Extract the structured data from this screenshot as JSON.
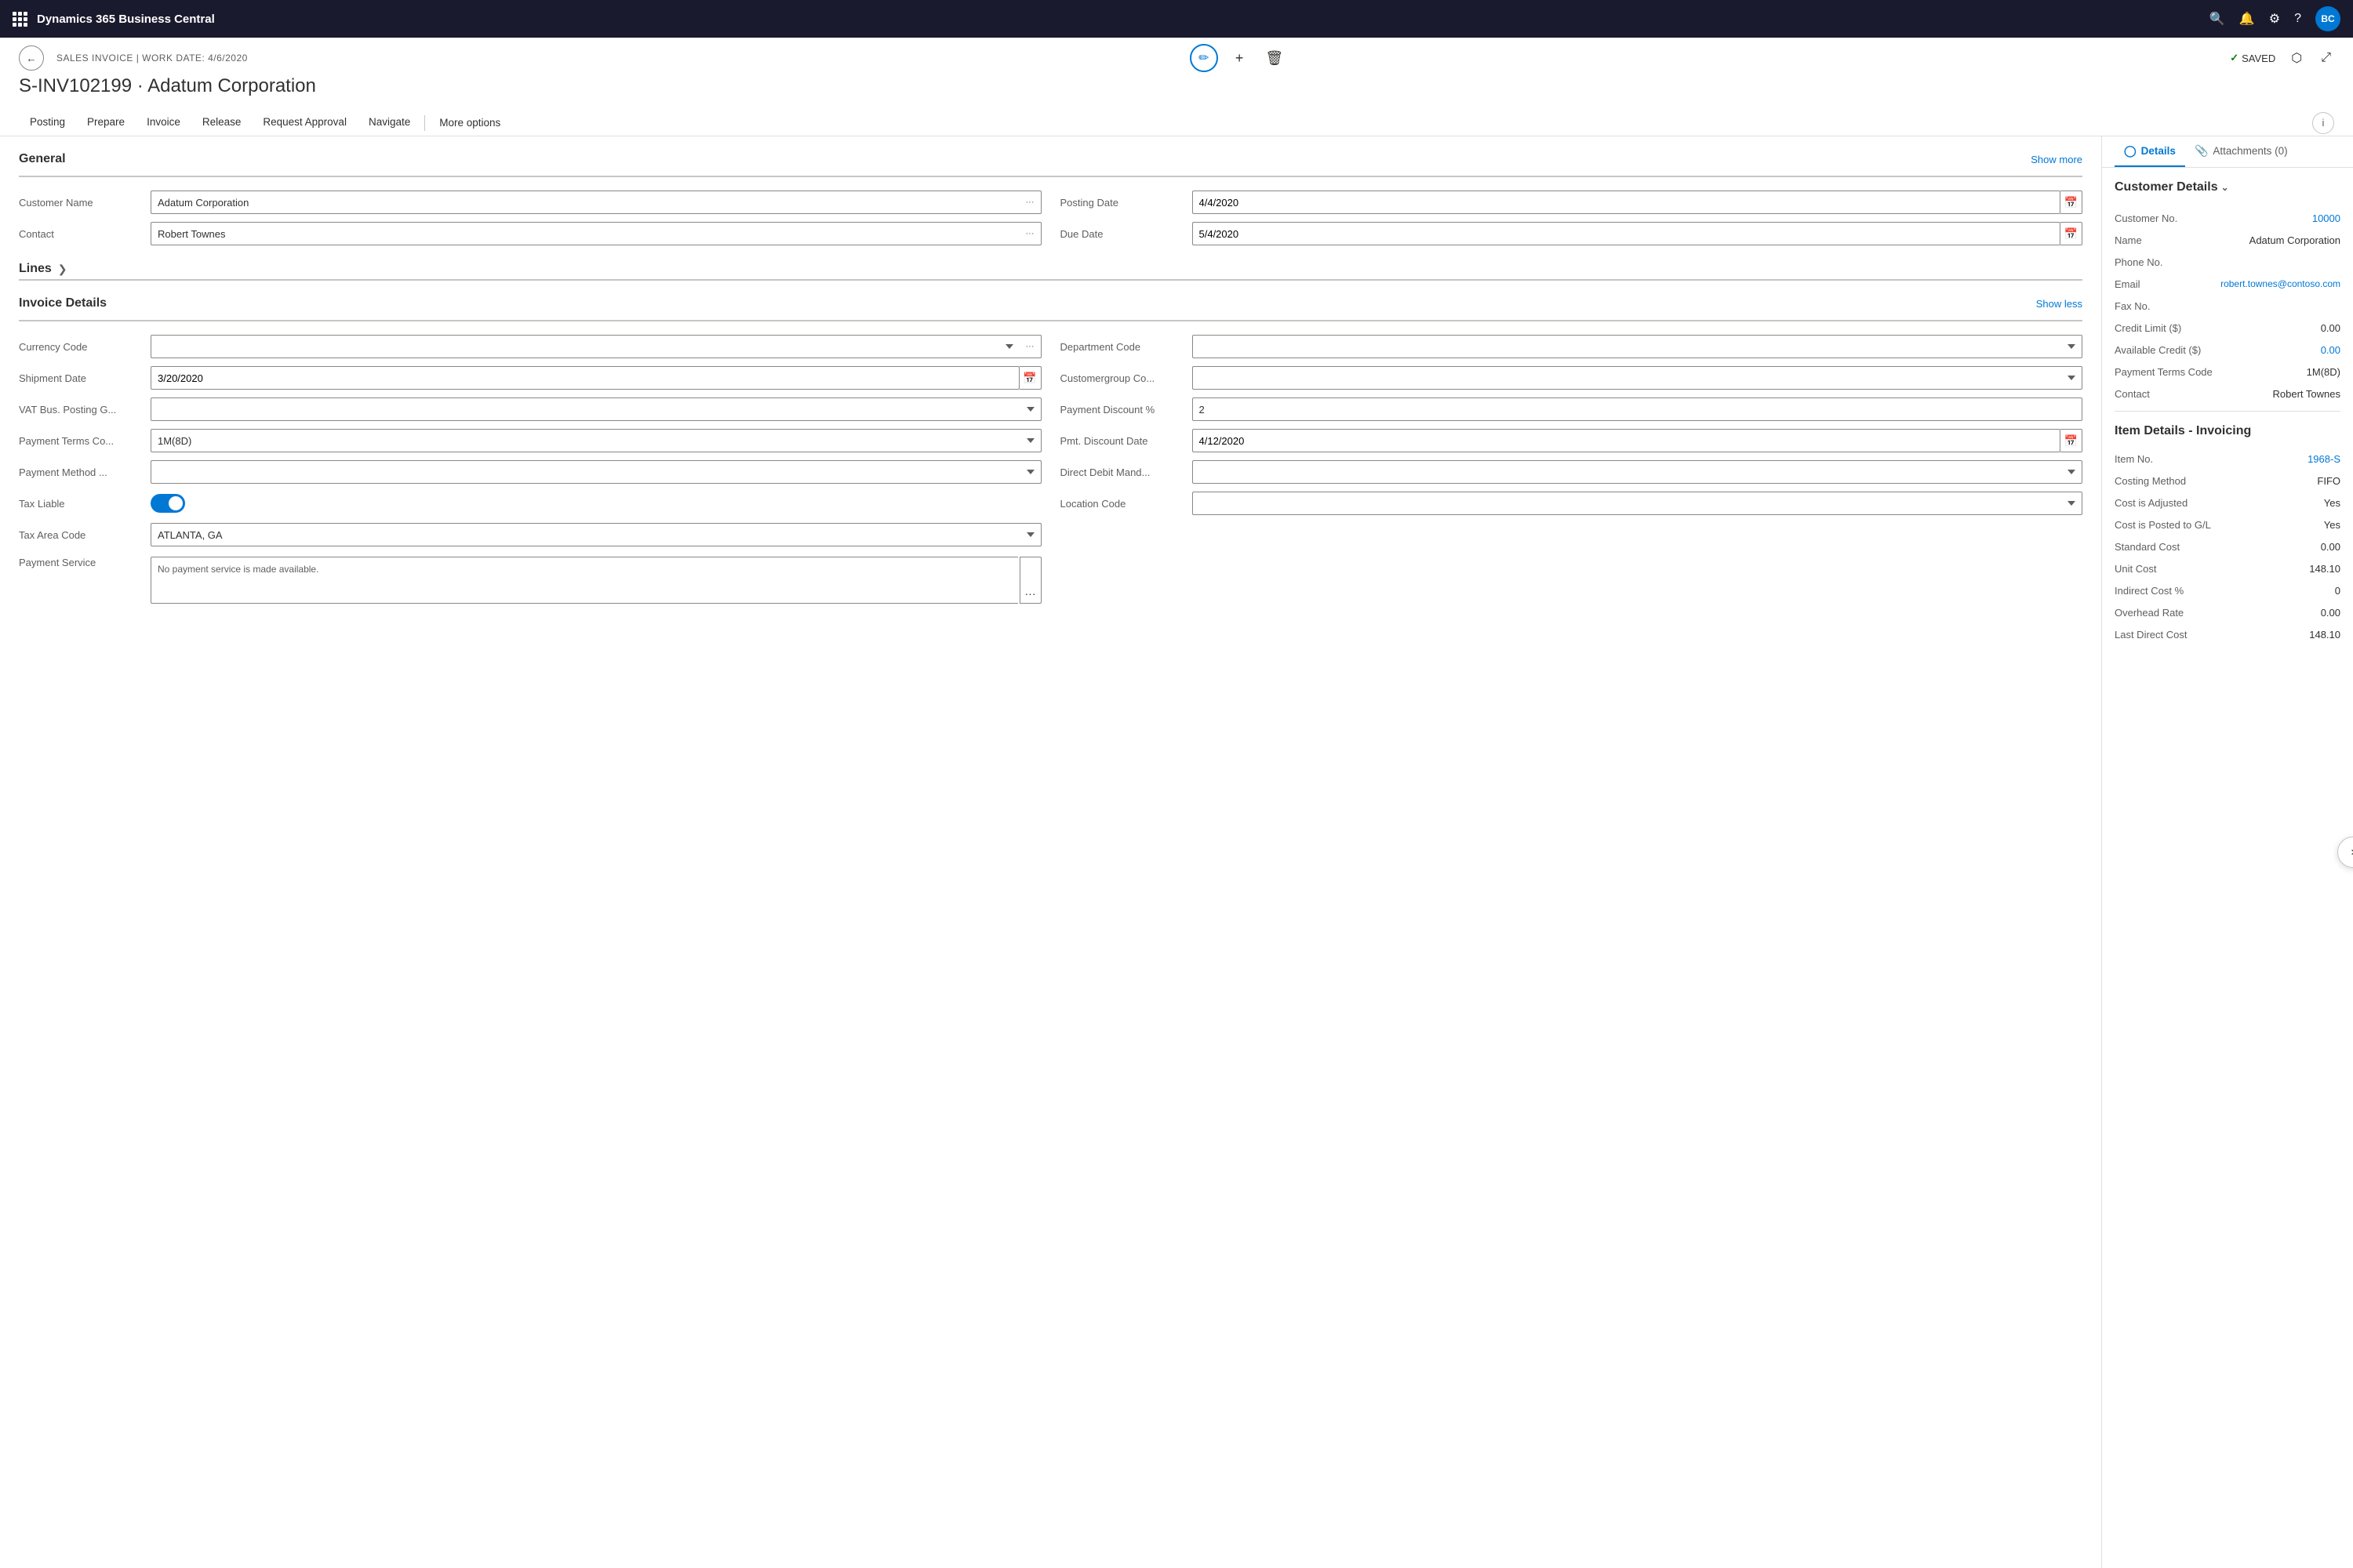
{
  "app": {
    "title": "Dynamics 365 Business Central",
    "user_initials": "BC"
  },
  "page": {
    "breadcrumb": "SALES INVOICE | WORK DATE: 4/6/2020",
    "record_title": "S-INV102199 · Adatum Corporation",
    "saved_label": "SAVED"
  },
  "action_bar": {
    "items": [
      "Posting",
      "Prepare",
      "Invoice",
      "Release",
      "Request Approval",
      "Navigate"
    ],
    "more_options": "More options"
  },
  "general": {
    "title": "General",
    "show_more": "Show more",
    "fields": {
      "customer_name_label": "Customer Name",
      "customer_name_value": "Adatum Corporation",
      "contact_label": "Contact",
      "contact_value": "Robert Townes",
      "posting_date_label": "Posting Date",
      "posting_date_value": "4/4/2020",
      "due_date_label": "Due Date",
      "due_date_value": "5/4/2020"
    }
  },
  "lines": {
    "title": "Lines"
  },
  "invoice_details": {
    "title": "Invoice Details",
    "show_less": "Show less",
    "fields": {
      "currency_code_label": "Currency Code",
      "currency_code_value": "",
      "shipment_date_label": "Shipment Date",
      "shipment_date_value": "3/20/2020",
      "vat_bus_posting_label": "VAT Bus. Posting G...",
      "vat_bus_posting_value": "",
      "payment_terms_label": "Payment Terms Co...",
      "payment_terms_value": "1M(8D)",
      "payment_method_label": "Payment Method ...",
      "payment_method_value": "",
      "tax_liable_label": "Tax Liable",
      "tax_area_code_label": "Tax Area Code",
      "tax_area_code_value": "ATLANTA, GA",
      "payment_service_label": "Payment Service",
      "payment_service_text": "No payment service is made available.",
      "department_code_label": "Department Code",
      "department_code_value": "",
      "customergroup_label": "Customergroup Co...",
      "customergroup_value": "",
      "payment_discount_label": "Payment Discount %",
      "payment_discount_value": "2",
      "pmt_discount_date_label": "Pmt. Discount Date",
      "pmt_discount_date_value": "4/12/2020",
      "direct_debit_label": "Direct Debit Mand...",
      "direct_debit_value": "",
      "location_code_label": "Location Code",
      "location_code_value": ""
    }
  },
  "right_panel": {
    "tabs": {
      "details": "Details",
      "attachments": "Attachments (0)"
    },
    "customer_details": {
      "title": "Customer Details",
      "customer_no_label": "Customer No.",
      "customer_no_value": "10000",
      "name_label": "Name",
      "name_value": "Adatum Corporation",
      "phone_no_label": "Phone No.",
      "phone_no_value": "",
      "email_label": "Email",
      "email_value": "robert.townes@contoso.com",
      "fax_no_label": "Fax No.",
      "fax_no_value": "",
      "credit_limit_label": "Credit Limit ($)",
      "credit_limit_value": "0.00",
      "available_credit_label": "Available Credit ($)",
      "available_credit_value": "0.00",
      "payment_terms_label": "Payment Terms Code",
      "payment_terms_value": "1M(8D)",
      "contact_label": "Contact",
      "contact_value": "Robert Townes"
    },
    "item_details": {
      "title": "Item Details - Invoicing",
      "item_no_label": "Item No.",
      "item_no_value": "1968-S",
      "costing_method_label": "Costing Method",
      "costing_method_value": "FIFO",
      "cost_is_adjusted_label": "Cost is Adjusted",
      "cost_is_adjusted_value": "Yes",
      "cost_is_posted_label": "Cost is Posted to G/L",
      "cost_is_posted_value": "Yes",
      "standard_cost_label": "Standard Cost",
      "standard_cost_value": "0.00",
      "unit_cost_label": "Unit Cost",
      "unit_cost_value": "148.10",
      "indirect_cost_label": "Indirect Cost %",
      "indirect_cost_value": "0",
      "overhead_rate_label": "Overhead Rate",
      "overhead_rate_value": "0.00",
      "last_direct_cost_label": "Last Direct Cost",
      "last_direct_cost_value": "148.10"
    }
  }
}
